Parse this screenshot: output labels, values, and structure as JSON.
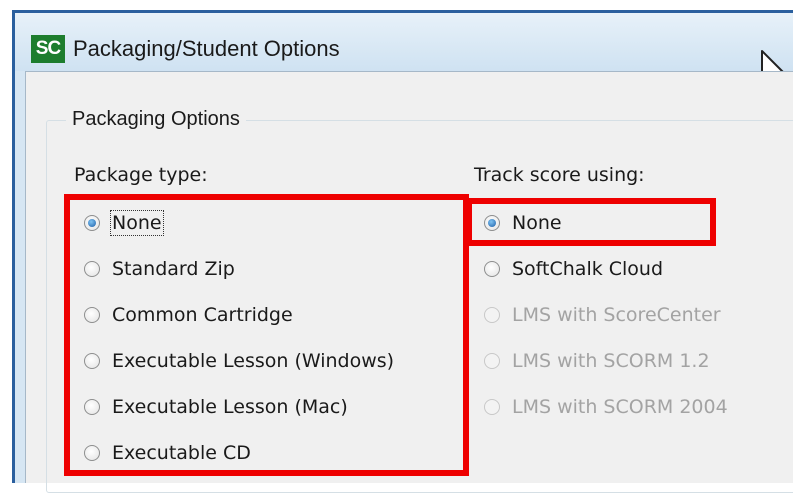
{
  "window": {
    "app_icon_text": "SC",
    "title": "Packaging/Student Options"
  },
  "group": {
    "legend": "Packaging Options"
  },
  "package_type": {
    "label": "Package type:",
    "options": [
      {
        "label": "None",
        "checked": true
      },
      {
        "label": "Standard Zip",
        "checked": false
      },
      {
        "label": "Common Cartridge",
        "checked": false
      },
      {
        "label": "Executable Lesson (Windows)",
        "checked": false
      },
      {
        "label": "Executable Lesson (Mac)",
        "checked": false
      },
      {
        "label": "Executable CD",
        "checked": false
      }
    ]
  },
  "track_score": {
    "label": "Track score using:",
    "options": [
      {
        "label": "None",
        "checked": true,
        "enabled": true
      },
      {
        "label": "SoftChalk Cloud",
        "checked": false,
        "enabled": true
      },
      {
        "label": "LMS with ScoreCenter",
        "checked": false,
        "enabled": false
      },
      {
        "label": "LMS with SCORM 1.2",
        "checked": false,
        "enabled": false
      },
      {
        "label": "LMS with SCORM 2004",
        "checked": false,
        "enabled": false
      }
    ]
  },
  "colors": {
    "highlight": "#ee0000",
    "title_border": "#2a5f9e",
    "app_icon": "#1d7d2e"
  },
  "icons": [
    "app-icon",
    "cursor-icon",
    "radio-icon"
  ]
}
